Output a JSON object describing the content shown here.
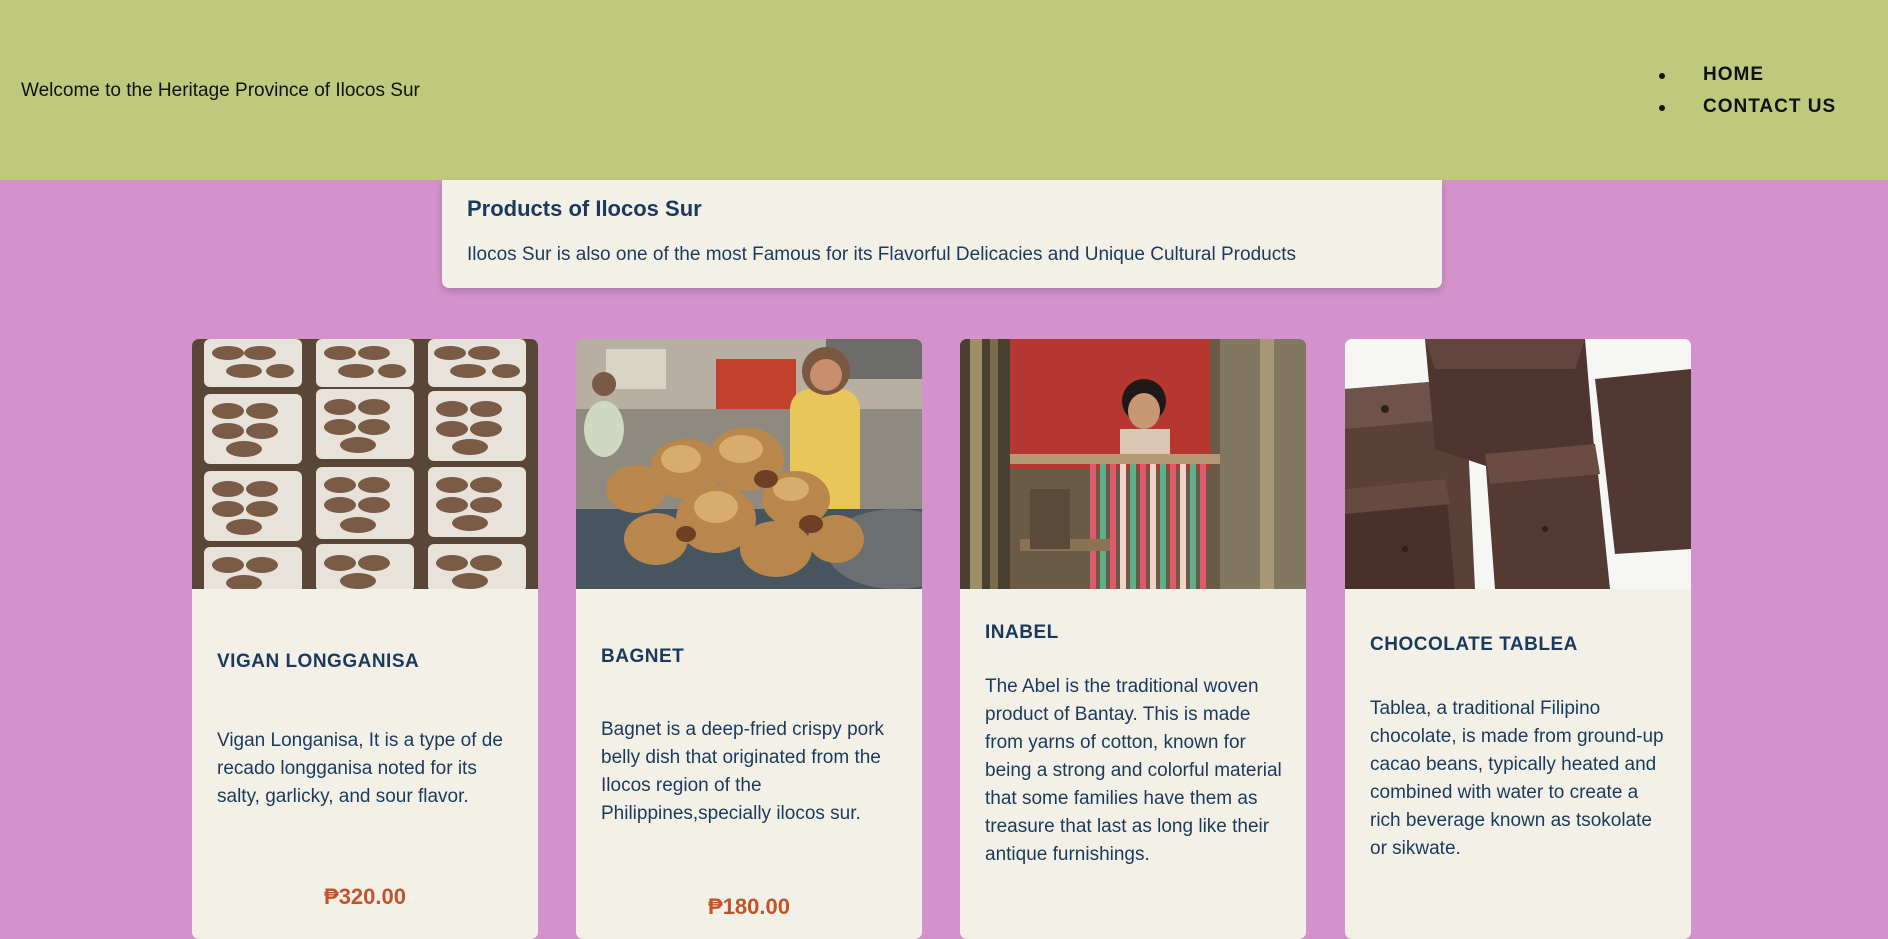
{
  "header": {
    "welcome": "Welcome to the Heritage Province of Ilocos Sur",
    "nav": [
      "HOME",
      "CONTACT US"
    ]
  },
  "intro": {
    "title": "Products of Ilocos Sur",
    "text": "Ilocos Sur is also one of the most Famous for its Flavorful Delicacies and Unique Cultural Products"
  },
  "products": [
    {
      "name": "VIGAN LONGGANISA",
      "description": "Vigan Longanisa, It is a type of de recado longganisa noted for its salty, garlicky, and sour flavor.",
      "price": "₱320.00",
      "image": "longganisa-photo"
    },
    {
      "name": "BAGNET",
      "description": "Bagnet is a deep-fried crispy pork belly dish that originated from the Ilocos region of the Philippines,specially ilocos sur.",
      "price": "₱180.00",
      "image": "bagnet-photo"
    },
    {
      "name": "INABEL",
      "description": "The Abel is the traditional woven product of Bantay. This is made from yarns of cotton, known for being a strong and colorful material that some families have them as treasure that last as long like their antique furnishings.",
      "image": "inabel-weaving-photo"
    },
    {
      "name": "CHOCOLATE TABLEA",
      "description": "Tablea, a traditional Filipino chocolate, is made from ground-up cacao beans, typically heated and combined with water to create a rich beverage known as tsokolate or sikwate.",
      "image": "chocolate-tablea-photo"
    }
  ],
  "colors": {
    "page_bg": "#d392cb",
    "header_bg": "#bfc97e",
    "card_bg": "#f3f1e7",
    "text": "#1b3a5b",
    "price": "#c2542b"
  }
}
